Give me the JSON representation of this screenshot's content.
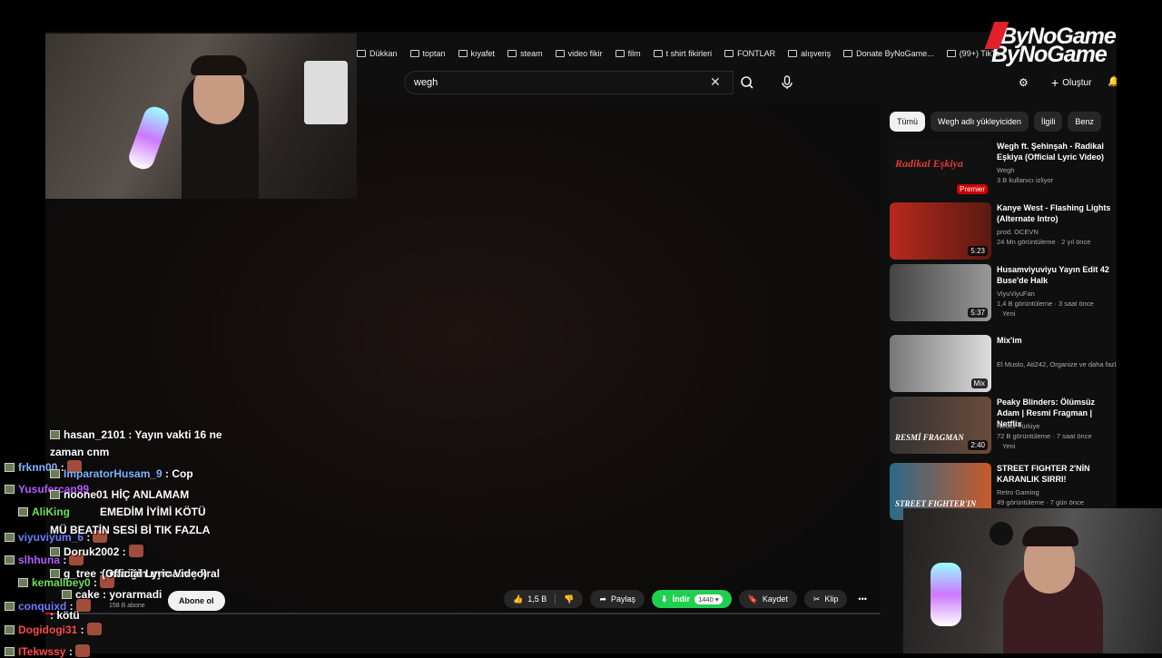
{
  "browser": {
    "bookmarks": [
      "Dükkan",
      "toptan",
      "kıyafet",
      "steam",
      "video fikir",
      "film",
      "t shirt fikirleri",
      "FONTLAR",
      "alışveriş",
      "Donate ByNoGame...",
      "(99+) TikTo"
    ]
  },
  "youtube": {
    "search_value": "wegh",
    "create_label": "Oluştur",
    "chips": [
      "Tümü",
      "Wegh adlı yükleyiciden",
      "İlgili",
      "Benz"
    ],
    "recommendations": [
      {
        "title": "Wegh ft. Şehinşah - Radikal Eşkiya (Official Lyric Video)",
        "channel": "Wegh",
        "meta": "3 B kullanıcı izliyor",
        "badge": "Premier",
        "thumb_text": "Radikal Eşkiya",
        "duration": ""
      },
      {
        "title": "Kanye West - Flashing Lights (Alternate Intro)",
        "channel": "prod. OCEVN",
        "meta": "24 Mn görüntüleme · 2 yıl önce",
        "badge": "",
        "thumb_text": "",
        "duration": "5:23"
      },
      {
        "title": "Husamviyuviyu Yayın Edit 42 Buse'de Halk",
        "channel": "ViyuViyuFan",
        "meta": "1,4 B görüntüleme · 3 saat önce",
        "badge": "Yeni",
        "thumb_text": "",
        "duration": "5:37"
      },
      {
        "title": "Mix'im",
        "channel": "El Musto, Ati242, Organize ve daha fazlası",
        "meta": "",
        "badge": "",
        "thumb_text": "",
        "duration": "Mix"
      },
      {
        "title": "Peaky Blinders: Ölümsüz Adam | Resmi Fragman | Netflix",
        "channel": "Netflix Türkiye",
        "meta": "72 B görüntüleme · 7 saat önce",
        "badge": "Yeni",
        "thumb_text": "RESMİ FRAGMAN",
        "duration": "2:40"
      },
      {
        "title": "STREET FIGHTER 2'NİN KARANLIK SIRRI!",
        "channel": "Retro Gaming",
        "meta": "49 görüntüleme · 7 gün önce",
        "badge": "",
        "thumb_text": "STREET FIGHTER'IN",
        "duration": ""
      }
    ],
    "actions": {
      "likes": "1,5 B",
      "share": "Paylaş",
      "download": "İndir",
      "quality": "1440",
      "save": "Kaydet",
      "clip": "Klip"
    },
    "subscribe": "Abone ol",
    "subs_count": "158 B abone",
    "progress": 0.01
  },
  "overlay": {
    "logo": "ByNoGame",
    "video_title_fragment": "(Official Lyric Video)"
  },
  "chat": [
    {
      "user": "hasan_2101",
      "color": "#ffffff",
      "msg": " : Yayın vakti 16 ne"
    },
    {
      "user": "",
      "color": "#ffffff",
      "msg": "zaman cnm"
    },
    {
      "user": "frknn00",
      "color": "#7fb4ff",
      "msg": " :"
    },
    {
      "user": "ImparatorHusam_9",
      "color": "#7fb4ff",
      "msg": " : Cop"
    },
    {
      "user": "Yusufercan99",
      "color": "#b35cff",
      "msg": ""
    },
    {
      "user": "noone01",
      "color": "#ffffff",
      "msg": " HİÇ ANLAMAM"
    },
    {
      "user": "AliKing",
      "color": "#6ee05a",
      "msg": ""
    },
    {
      "user": "",
      "color": "#ffffff",
      "msg": "EMEDİM İYİMİ KÖTÜ"
    },
    {
      "user": "viyuviyum_6",
      "color": "#6d7dff",
      "msg": " :"
    },
    {
      "user": "",
      "color": "#ffffff",
      "msg": "MÜ BEATİN SESİ Bİ TIK FAZLA"
    },
    {
      "user": "slhhuna",
      "color": "#b35cff",
      "msg": " :"
    },
    {
      "user": "Doruk2002",
      "color": "#ffffff",
      "msg": " :"
    },
    {
      "user": "g_tree",
      "color": "#ffffff",
      "msg": " : müziğin uymamış kral"
    },
    {
      "user": "kemallbey0",
      "color": "#6ee05a",
      "msg": " :"
    },
    {
      "user": "cake",
      "color": "#ffffff",
      "msg": " : yorarmadi"
    },
    {
      "user": "conquixd",
      "color": "#6d7dff",
      "msg": " :"
    },
    {
      "user": "",
      "color": "#ffffff",
      "msg": " : kötü"
    },
    {
      "user": "Dogidogi31",
      "color": "#ff4a4a",
      "msg": " :"
    },
    {
      "user": "ITekwssy",
      "color": "#ff4a4a",
      "msg": " :"
    }
  ]
}
